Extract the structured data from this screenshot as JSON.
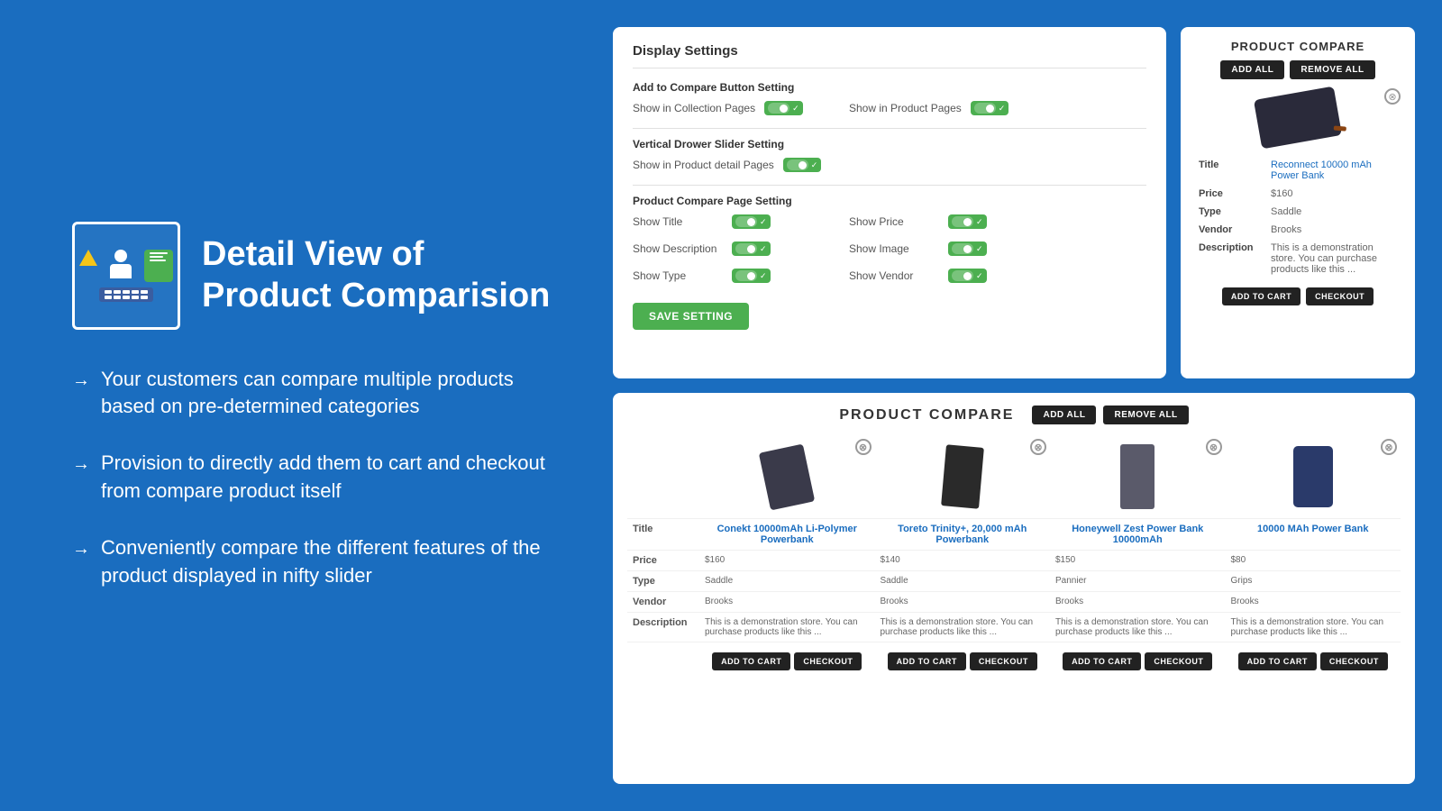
{
  "left": {
    "title_line1": "Detail View of",
    "title_line2": "Product Comparision",
    "bullets": [
      "Your customers can compare multiple products based on pre-determined categories",
      "Provision to directly add them to cart and checkout from compare product itself",
      "Conveniently compare the different features of the product displayed in nifty slider"
    ]
  },
  "settings_card": {
    "title": "Display Settings",
    "section1": {
      "label": "Add to Compare Button Setting",
      "items": [
        {
          "label": "Show in Collection Pages",
          "enabled": true
        },
        {
          "label": "Show in Product Pages",
          "enabled": true
        }
      ]
    },
    "section2": {
      "label": "Vertical Drower Slider Setting",
      "items": [
        {
          "label": "Show in Product detail Pages",
          "enabled": true
        }
      ]
    },
    "section3": {
      "label": "Product Compare Page Setting",
      "items": [
        {
          "label": "Show Title",
          "enabled": true
        },
        {
          "label": "Show Price",
          "enabled": true
        },
        {
          "label": "Show Description",
          "enabled": true
        },
        {
          "label": "Show Image",
          "enabled": true
        },
        {
          "label": "Show Type",
          "enabled": true
        },
        {
          "label": "Show Vendor",
          "enabled": true
        }
      ]
    },
    "save_button": "SAVE SETTING"
  },
  "small_compare": {
    "title": "PRODUCT COMPARE",
    "add_all": "ADD ALL",
    "remove_all": "REMOVE ALL",
    "product": {
      "title_label": "Title",
      "title_value": "Reconnect 10000 mAh Power Bank",
      "price_label": "Price",
      "price_value": "$160",
      "type_label": "Type",
      "type_value": "Saddle",
      "vendor_label": "Vendor",
      "vendor_value": "Brooks",
      "description_label": "Description",
      "description_value": "This is a demonstration store. You can purchase products like this ..."
    },
    "add_to_cart": "ADD TO CART",
    "checkout": "CHECKOUT"
  },
  "big_compare": {
    "title": "PRODUCT COMPARE",
    "add_all": "ADD ALL",
    "remove_all": "REMOVE ALL",
    "columns": {
      "title": "Title",
      "price": "Price",
      "type": "Type",
      "vendor": "Vendor",
      "description": "Description"
    },
    "products": [
      {
        "name": "Conekt 10000mAh Li-Polymer Powerbank",
        "price": "$160",
        "type": "Saddle",
        "vendor": "Brooks",
        "description": "This is a demonstration store. You can purchase products like this ..."
      },
      {
        "name": "Toreto Trinity+, 20,000 mAh Powerbank",
        "price": "$140",
        "type": "Saddle",
        "vendor": "Brooks",
        "description": "This is a demonstration store. You can purchase products like this ..."
      },
      {
        "name": "Honeywell Zest Power Bank 10000mAh",
        "price": "$150",
        "type": "Pannier",
        "vendor": "Brooks",
        "description": "This is a demonstration store. You can purchase products like this ..."
      },
      {
        "name": "10000 MAh Power Bank",
        "price": "$80",
        "type": "Grips",
        "vendor": "Brooks",
        "description": "This is a demonstration store. You can purchase products like this ..."
      }
    ],
    "add_to_cart": "ADD TO CART",
    "checkout": "CHECKOUT"
  }
}
